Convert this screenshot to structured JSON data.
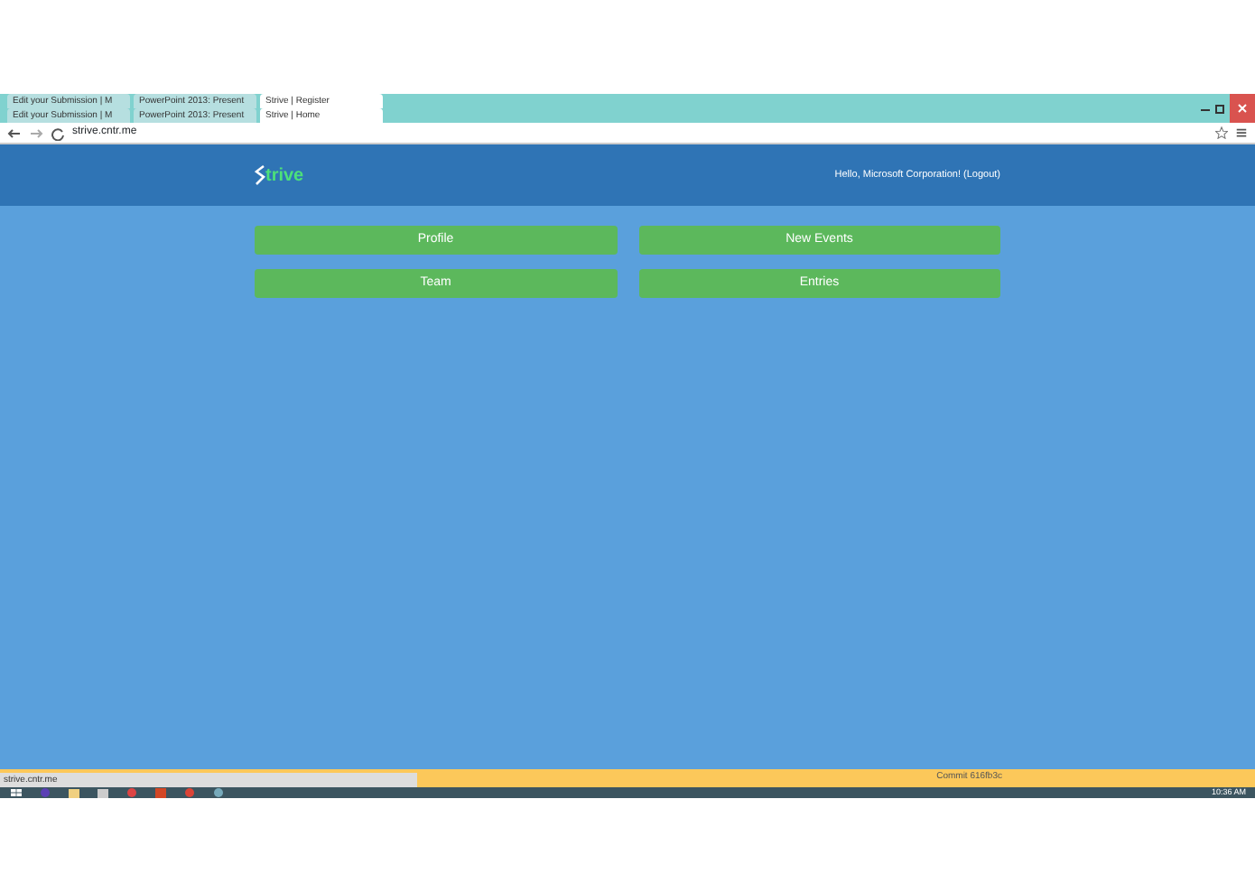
{
  "browser": {
    "tab_rows": [
      [
        {
          "title": "Edit your Submission | M",
          "selected": false
        },
        {
          "title": "PowerPoint 2013: Present",
          "selected": false
        },
        {
          "title": "Strive | Register",
          "selected": true
        }
      ],
      [
        {
          "title": "Edit your Submission | M",
          "selected": false
        },
        {
          "title": "PowerPoint 2013: Present",
          "selected": false
        },
        {
          "title": "Strive | Home",
          "selected": true
        }
      ]
    ],
    "url": "strive.cntr.me"
  },
  "header": {
    "logo": "trive",
    "greeting": "Hello, Microsoft Corporation! (Logout)"
  },
  "tiles": [
    {
      "label": "Profile"
    },
    {
      "label": "New Events"
    },
    {
      "label": "Team"
    },
    {
      "label": "Entries"
    }
  ],
  "footer": {
    "commit": "Commit 616fb3c"
  },
  "status_url": "strive.cntr.me",
  "taskbar": {
    "clock": "10:36 AM"
  }
}
